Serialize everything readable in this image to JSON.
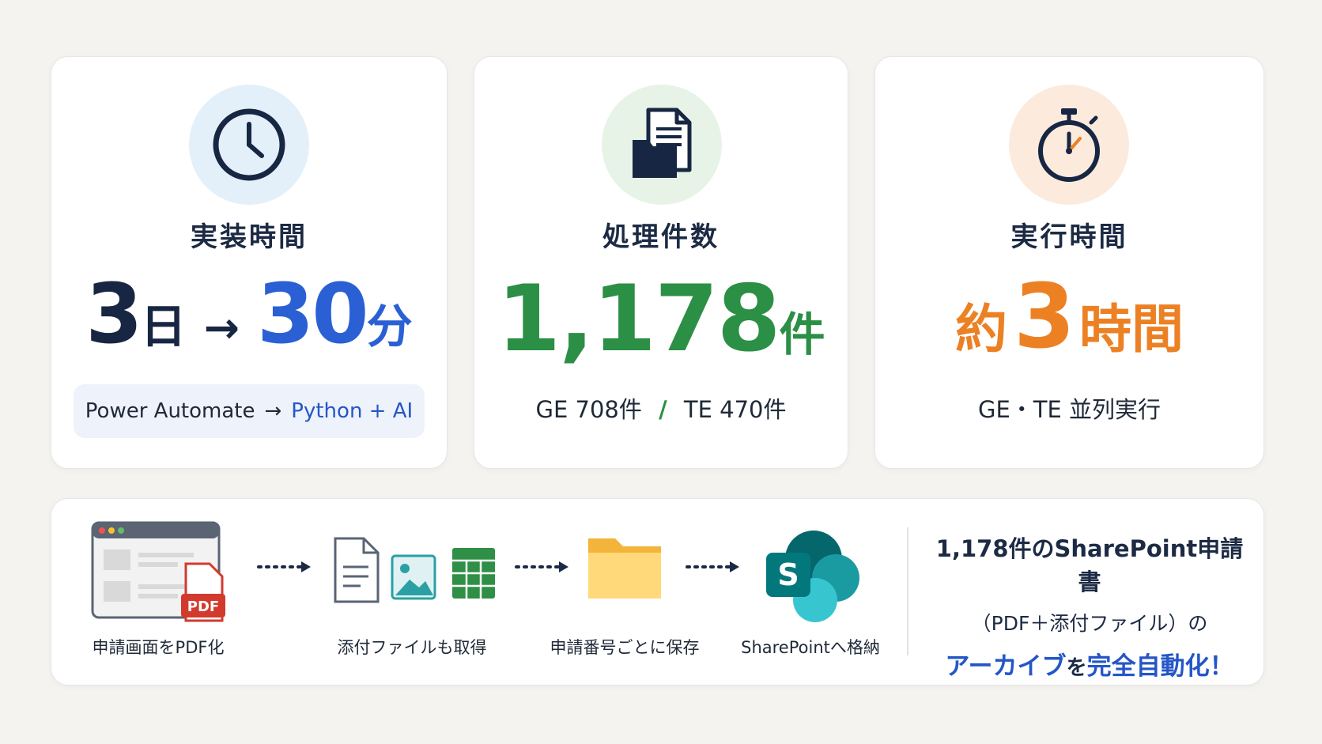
{
  "cards": [
    {
      "title": "実装時間",
      "from_num": "3",
      "from_unit": "日",
      "arrow": "→",
      "to_num": "30",
      "to_unit": "分",
      "pill_from": "Power Automate",
      "pill_arrow": "→",
      "pill_to": "Python + AI",
      "icon": "clock-icon"
    },
    {
      "title": "処理件数",
      "num": "1,178",
      "unit": "件",
      "sub_left": "GE 708件",
      "sub_sep": "/",
      "sub_right": "TE 470件",
      "icon": "document-folder-icon"
    },
    {
      "title": "実行時間",
      "prefix": "約",
      "num": "3",
      "unit": "時間",
      "sub": "GE・TE 並列実行",
      "icon": "stopwatch-icon"
    }
  ],
  "flow": [
    {
      "label": "申請画面をPDF化",
      "icon": "browser-pdf-icon",
      "badge": "PDF"
    },
    {
      "label": "添付ファイルも取得",
      "icon": "document-image-spreadsheet-icon"
    },
    {
      "label": "申請番号ごとに保存",
      "icon": "folder-icon"
    },
    {
      "label": "SharePointへ格納",
      "icon": "sharepoint-icon",
      "badge": "S"
    }
  ],
  "summary": {
    "line1": "1,178件のSharePoint申請書",
    "line2": "（PDF＋添付ファイル）の",
    "line3_a": "アーカイブ",
    "line3_b": "を",
    "line3_c": "完全自動化！"
  },
  "colors": {
    "navy": "#172642",
    "blue": "#2a60d4",
    "green": "#2b8f45",
    "orange": "#ec8124",
    "background": "#f4f3ef"
  }
}
